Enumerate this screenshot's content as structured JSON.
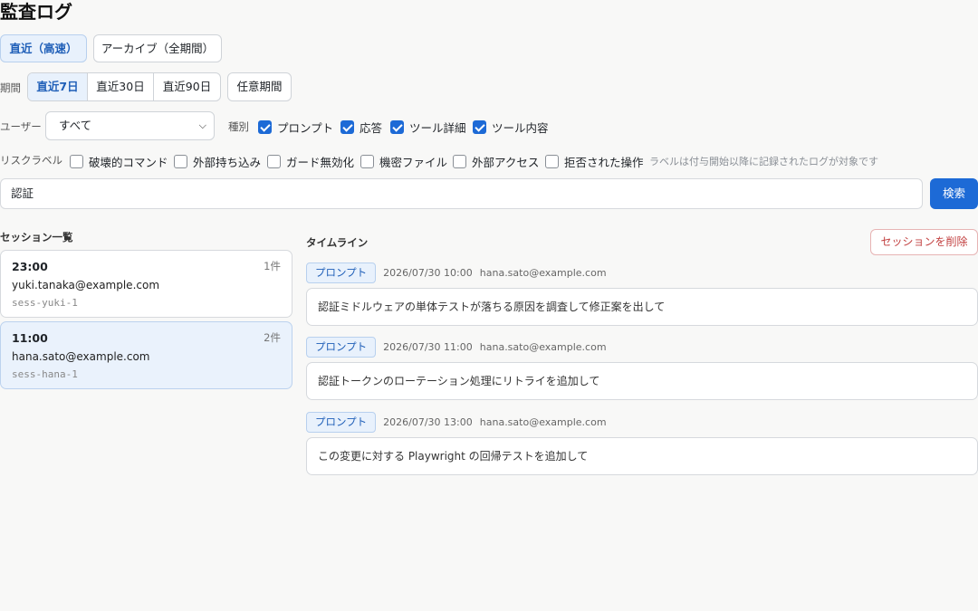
{
  "page": {
    "title": "監査ログ"
  },
  "source_tabs": [
    {
      "label": "直近（高速）",
      "active": true
    },
    {
      "label": "アーカイブ（全期間）",
      "active": false
    }
  ],
  "period": {
    "label": "期間",
    "options": [
      {
        "label": "直近7日",
        "active": true
      },
      {
        "label": "直近30日",
        "active": false
      },
      {
        "label": "直近90日",
        "active": false
      }
    ],
    "custom_label": "任意期間"
  },
  "user_filter": {
    "label": "ユーザー",
    "value": "すべて"
  },
  "type_filter": {
    "label": "種別",
    "options": [
      {
        "label": "プロンプト",
        "checked": true
      },
      {
        "label": "応答",
        "checked": true
      },
      {
        "label": "ツール詳細",
        "checked": true
      },
      {
        "label": "ツール内容",
        "checked": true
      }
    ]
  },
  "risk_filter": {
    "label": "リスクラベル",
    "options": [
      {
        "label": "破壊的コマンド",
        "checked": false
      },
      {
        "label": "外部持ち込み",
        "checked": false
      },
      {
        "label": "ガード無効化",
        "checked": false
      },
      {
        "label": "機密ファイル",
        "checked": false
      },
      {
        "label": "外部アクセス",
        "checked": false
      },
      {
        "label": "拒否された操作",
        "checked": false
      }
    ],
    "hint": "ラベルは付与開始以降に記録されたログが対象です"
  },
  "search": {
    "value": "認証",
    "button_label": "検索"
  },
  "sessions": {
    "heading": "セッション一覧",
    "items": [
      {
        "time": "23:00",
        "count": "1件",
        "user": "yuki.tanaka@example.com",
        "id": "sess-yuki-1",
        "selected": false
      },
      {
        "time": "11:00",
        "count": "2件",
        "user": "hana.sato@example.com",
        "id": "sess-hana-1",
        "selected": true
      }
    ]
  },
  "timeline": {
    "heading": "タイムライン",
    "delete_label": "セッションを削除",
    "entries": [
      {
        "tag": "プロンプト",
        "timestamp": "2026/07/30 10:00",
        "user": "hana.sato@example.com",
        "text": "認証ミドルウェアの単体テストが落ちる原因を調査して修正案を出して"
      },
      {
        "tag": "プロンプト",
        "timestamp": "2026/07/30 11:00",
        "user": "hana.sato@example.com",
        "text": "認証トークンのローテーション処理にリトライを追加して"
      },
      {
        "tag": "プロンプト",
        "timestamp": "2026/07/30 13:00",
        "user": "hana.sato@example.com",
        "text": "この変更に対する Playwright の回帰テストを追加して"
      }
    ]
  },
  "colors": {
    "accent": "#1d6ad6",
    "danger": "#c24040",
    "background": "#f8f8f7"
  }
}
